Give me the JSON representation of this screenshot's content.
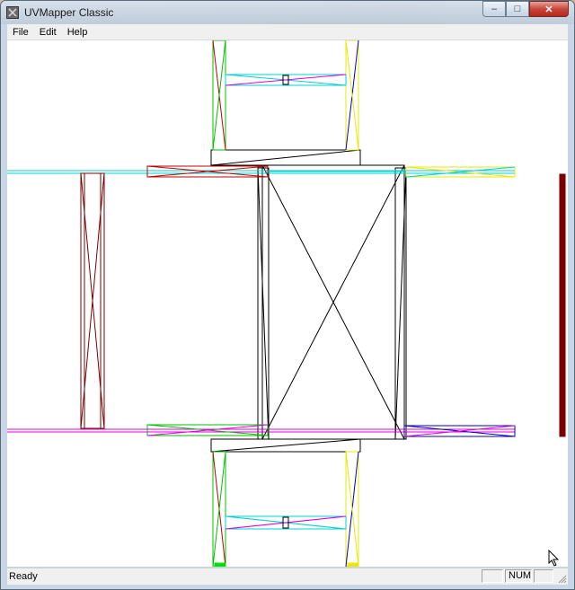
{
  "window": {
    "title": "UVMapper Classic"
  },
  "caption_buttons": {
    "minimize": "–",
    "maximize": "□",
    "close": "✕"
  },
  "menu": {
    "items": [
      "File",
      "Edit",
      "Help"
    ]
  },
  "status": {
    "text": "Ready",
    "panes": [
      "",
      "NUM",
      ""
    ]
  },
  "colors": {
    "black": "#000000",
    "cyan": "#00e0e0",
    "magenta": "#e000e0",
    "green": "#00e000",
    "yellow": "#e8e800",
    "blue": "#0000c0",
    "red": "#c00000",
    "dark_red": "#7a0000"
  },
  "icons": [
    "app-icon",
    "minimize-icon",
    "maximize-icon",
    "close-icon",
    "size-grip-icon",
    "mouse-cursor-icon"
  ]
}
